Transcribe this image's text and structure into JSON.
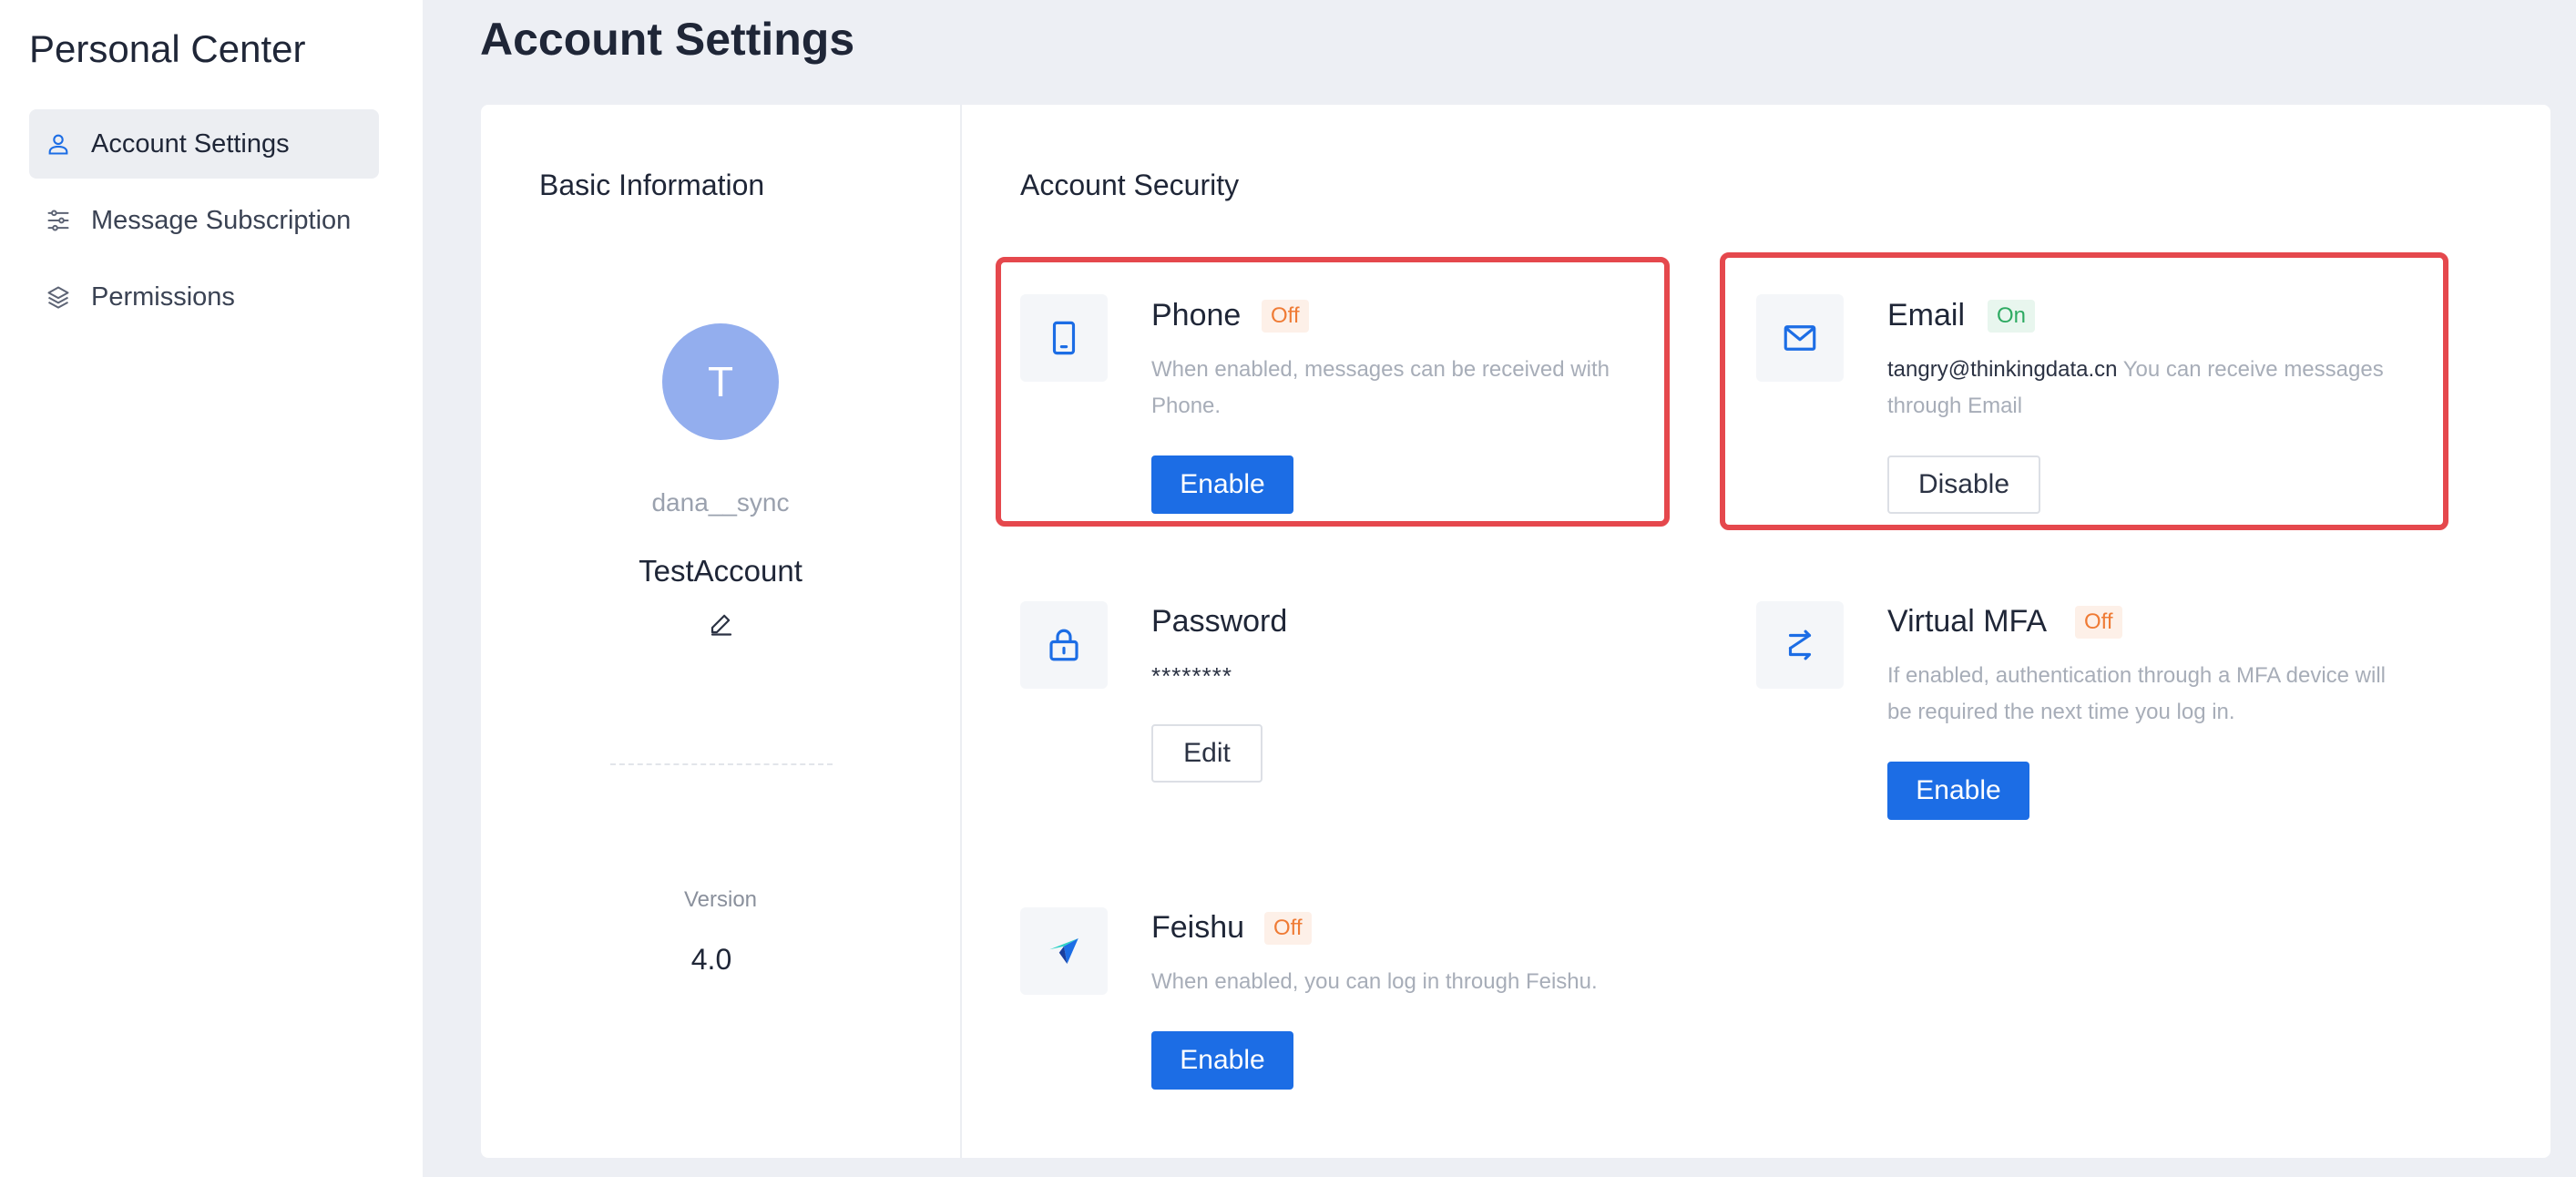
{
  "sidebar": {
    "title": "Personal Center",
    "items": [
      {
        "label": "Account Settings",
        "icon": "user-icon",
        "active": true
      },
      {
        "label": "Message Subscription",
        "icon": "sliders-icon",
        "active": false
      },
      {
        "label": "Permissions",
        "icon": "layers-icon",
        "active": false
      }
    ]
  },
  "page": {
    "title": "Account Settings"
  },
  "basic_info": {
    "title": "Basic Information",
    "avatar_initial": "T",
    "username": "dana__sync",
    "account_name": "TestAccount",
    "version_label": "Version",
    "version_value": "4.0"
  },
  "security": {
    "title": "Account Security",
    "phone": {
      "name": "Phone",
      "status": "Off",
      "desc_1": "When enabled, messages can be received with",
      "desc_2": "Phone.",
      "button": "Enable"
    },
    "email": {
      "name": "Email",
      "status": "On",
      "address": "tangry@thinkingdata.cn",
      "desc_1": "You can receive messages",
      "desc_2": "through Email",
      "button": "Disable"
    },
    "password": {
      "name": "Password",
      "mask": "********",
      "button": "Edit"
    },
    "mfa": {
      "name": "Virtual MFA",
      "status": "Off",
      "desc_1": "If enabled, authentication through a MFA device will",
      "desc_2": "be required the next time you log in.",
      "button": "Enable"
    },
    "feishu": {
      "name": "Feishu",
      "status": "Off",
      "desc_1": "When enabled, you can log in through Feishu.",
      "button": "Enable"
    }
  },
  "colors": {
    "primary": "#1c6de5",
    "highlight": "#e5484d",
    "off": "#ef7b35",
    "on": "#2eaa62",
    "avatar": "#93aeee"
  }
}
